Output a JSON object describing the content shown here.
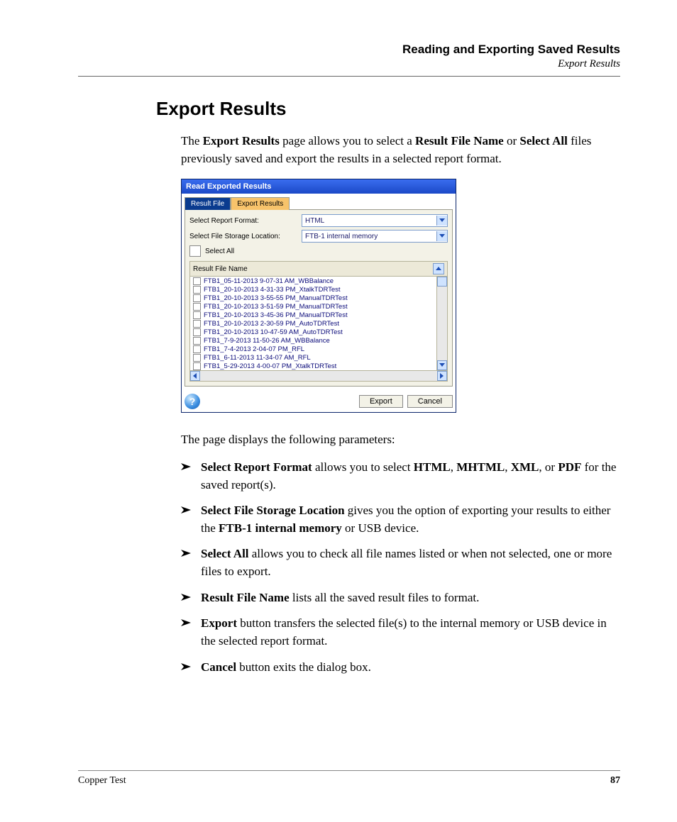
{
  "header": {
    "chapter": "Reading and Exporting Saved Results",
    "section": "Export Results"
  },
  "title": "Export Results",
  "intro": {
    "p1a": "The ",
    "p1b": "Export Results",
    "p1c": " page allows you to select a ",
    "p1d": "Result File Name",
    "p1e": " or ",
    "p1f": "Select All",
    "p1g": " files previously saved and export the results in a selected report format."
  },
  "shot": {
    "title": "Read Exported Results",
    "tabs": {
      "inactive": "Result File",
      "active": "Export Results"
    },
    "row1_label": "Select Report Format:",
    "row1_value": "HTML",
    "row2_label": "Select File Storage Location:",
    "row2_value": "FTB-1 internal memory",
    "selectall": "Select All",
    "list_header": "Result File Name",
    "files": [
      "FTB1_05-11-2013 9-07-31 AM_WBBalance",
      "FTB1_20-10-2013 4-31-33 PM_XtalkTDRTest",
      "FTB1_20-10-2013 3-55-55 PM_ManualTDRTest",
      "FTB1_20-10-2013 3-51-59 PM_ManualTDRTest",
      "FTB1_20-10-2013 3-45-36 PM_ManualTDRTest",
      "FTB1_20-10-2013 2-30-59 PM_AutoTDRTest",
      "FTB1_20-10-2013 10-47-59 AM_AutoTDRTest",
      "FTB1_7-9-2013 11-50-26 AM_WBBalance",
      "FTB1_7-4-2013 2-04-07 PM_RFL",
      "FTB1_6-11-2013 11-34-07 AM_RFL",
      "FTB1_5-29-2013 4-00-07 PM_XtalkTDRTest"
    ],
    "export": "Export",
    "cancel": "Cancel"
  },
  "paragraph2": "The page displays the following parameters:",
  "bullets": [
    {
      "b": "Select Report Format",
      "t1": " allows you to select ",
      "b2": "HTML",
      "t2": ", ",
      "b3": "MHTML",
      "t3": ", ",
      "b4": "XML",
      "t4": ", or ",
      "b5": "PDF",
      "t5": " for the saved report(s)."
    },
    {
      "b": "Select File Storage Location",
      "t1": " gives you the option of exporting your results to either the ",
      "b2": "FTB-1 internal memory",
      "t2": " or USB device."
    },
    {
      "b": "Select All",
      "t1": " allows you to check all file names listed or when not selected, one or more files to export."
    },
    {
      "b": "Result File Name",
      "t1": " lists all the saved result files to format."
    },
    {
      "b": "Export",
      "t1": " button transfers the selected file(s) to the internal memory or USB device in the selected report format."
    },
    {
      "b": "Cancel",
      "t1": " button exits the dialog box."
    }
  ],
  "footer": {
    "left": "Copper Test",
    "right": "87"
  }
}
